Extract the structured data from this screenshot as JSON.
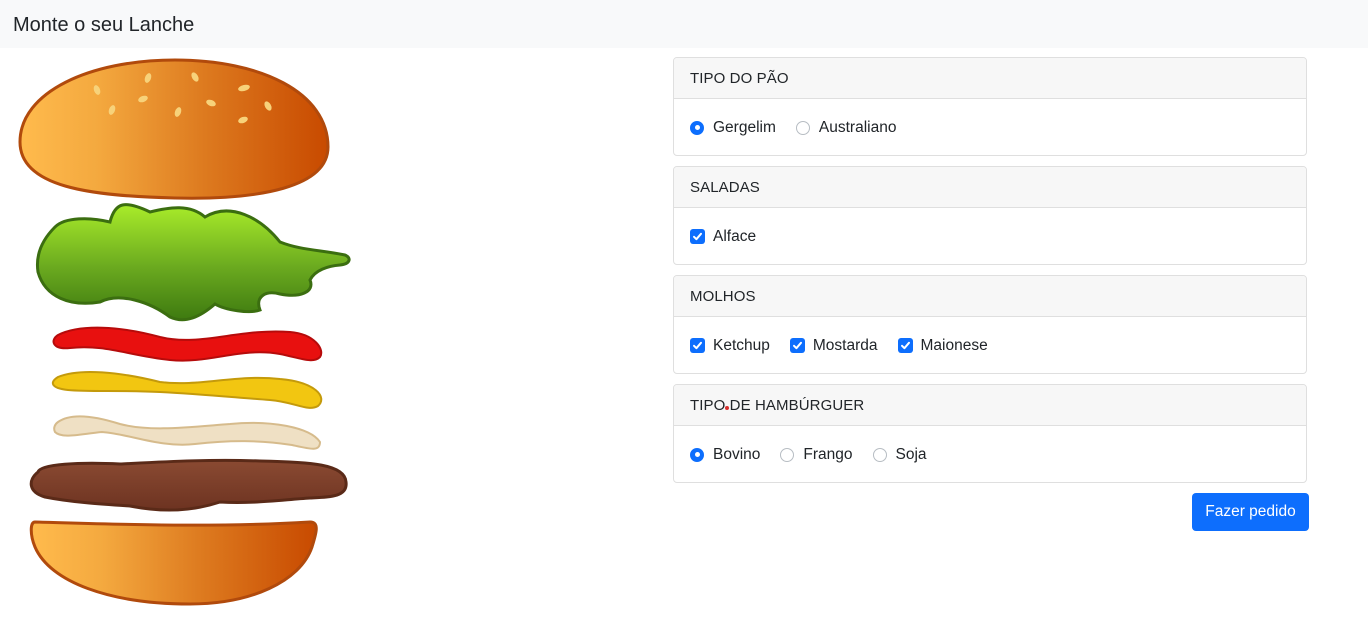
{
  "navbar": {
    "brand": "Monte o seu Lanche"
  },
  "sections": [
    {
      "title": "TIPO DO PÃO",
      "type": "radio",
      "options": [
        {
          "label": "Gergelim",
          "checked": true
        },
        {
          "label": "Australiano",
          "checked": false
        }
      ]
    },
    {
      "title": "SALADAS",
      "type": "checkbox",
      "options": [
        {
          "label": "Alface",
          "checked": true
        }
      ]
    },
    {
      "title": "MOLHOS",
      "type": "checkbox",
      "options": [
        {
          "label": "Ketchup",
          "checked": true
        },
        {
          "label": "Mostarda",
          "checked": true
        },
        {
          "label": "Maionese",
          "checked": true
        }
      ]
    },
    {
      "title": "TIPO DE HAMBÚRGUER",
      "type": "radio",
      "options": [
        {
          "label": "Bovino",
          "checked": true
        },
        {
          "label": "Frango",
          "checked": false
        },
        {
          "label": "Soja",
          "checked": false
        }
      ]
    }
  ],
  "submit_label": "Fazer pedido",
  "colors": {
    "accent": "#0d6efd",
    "navbar_bg": "#f8f9fa"
  }
}
